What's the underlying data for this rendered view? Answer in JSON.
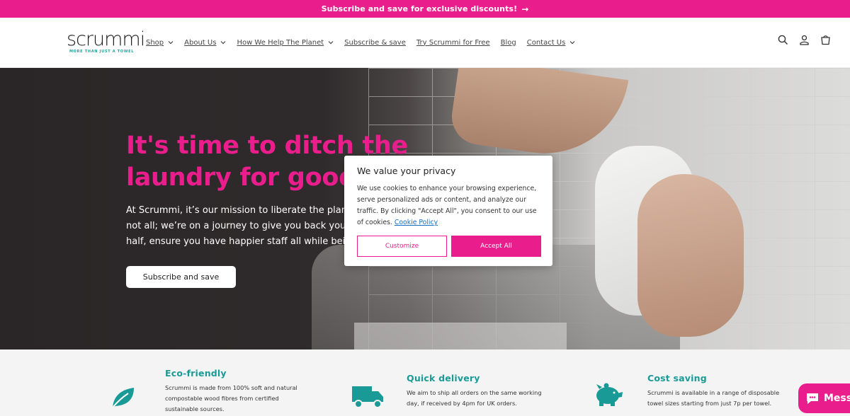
{
  "announcement": {
    "text": "Subscribe and save for exclusive discounts!",
    "arrow": "→"
  },
  "brand": {
    "logo_text": "scrummi",
    "tagline": "MORE THAN JUST A TOWEL"
  },
  "nav": {
    "items": [
      {
        "label": "Shop",
        "has_dropdown": true
      },
      {
        "label": "About Us",
        "has_dropdown": true
      },
      {
        "label": "How We Help The Planet",
        "has_dropdown": true
      },
      {
        "label": "Subscribe & save",
        "has_dropdown": false
      },
      {
        "label": "Try Scrummi for Free",
        "has_dropdown": false
      },
      {
        "label": "Blog",
        "has_dropdown": false
      },
      {
        "label": "Contact Us",
        "has_dropdown": true
      }
    ],
    "icons": [
      "search-icon",
      "account-icon",
      "cart-icon"
    ]
  },
  "hero": {
    "title_line1": "It's time to ditch the",
    "title_line2": "laundry for good",
    "body_line1": "At Scrummi, it’s our mission to liberate the planet fro",
    "body_line2": "not all; we’re on a journey to give you back your laun",
    "body_line3": "half, ensure you have happier staff all while being go",
    "cta": "Subscribe and save"
  },
  "privacy_modal": {
    "title": "We value your privacy",
    "body": "We use cookies to enhance your browsing experience, serve personalized ads or content, and analyze our traffic. By clicking \"Accept All\", you consent to our use of cookies.",
    "policy_link": "Cookie Policy",
    "customize": "Customize",
    "accept": "Accept All"
  },
  "features": [
    {
      "title": "Eco-friendly",
      "icon": "leaf-icon",
      "desc_lines": [
        "Scrummi is made from 100% soft and natural",
        "compostable wood fibres from certified",
        "sustainable sources."
      ]
    },
    {
      "title": "Quick delivery",
      "icon": "truck-icon",
      "desc_lines": [
        "We aim to ship all orders on the same working",
        "day, if received by 4pm for UK orders."
      ]
    },
    {
      "title": "Cost saving",
      "icon": "piggy-bank-icon",
      "desc_lines": [
        "Scrummi is available in a range of disposable",
        "towel sizes starting from just 7p per towel."
      ]
    }
  ],
  "chat": {
    "label": "Messa"
  },
  "colors": {
    "brand_pink": "#e91e8c",
    "brand_teal": "#1a9a97"
  }
}
